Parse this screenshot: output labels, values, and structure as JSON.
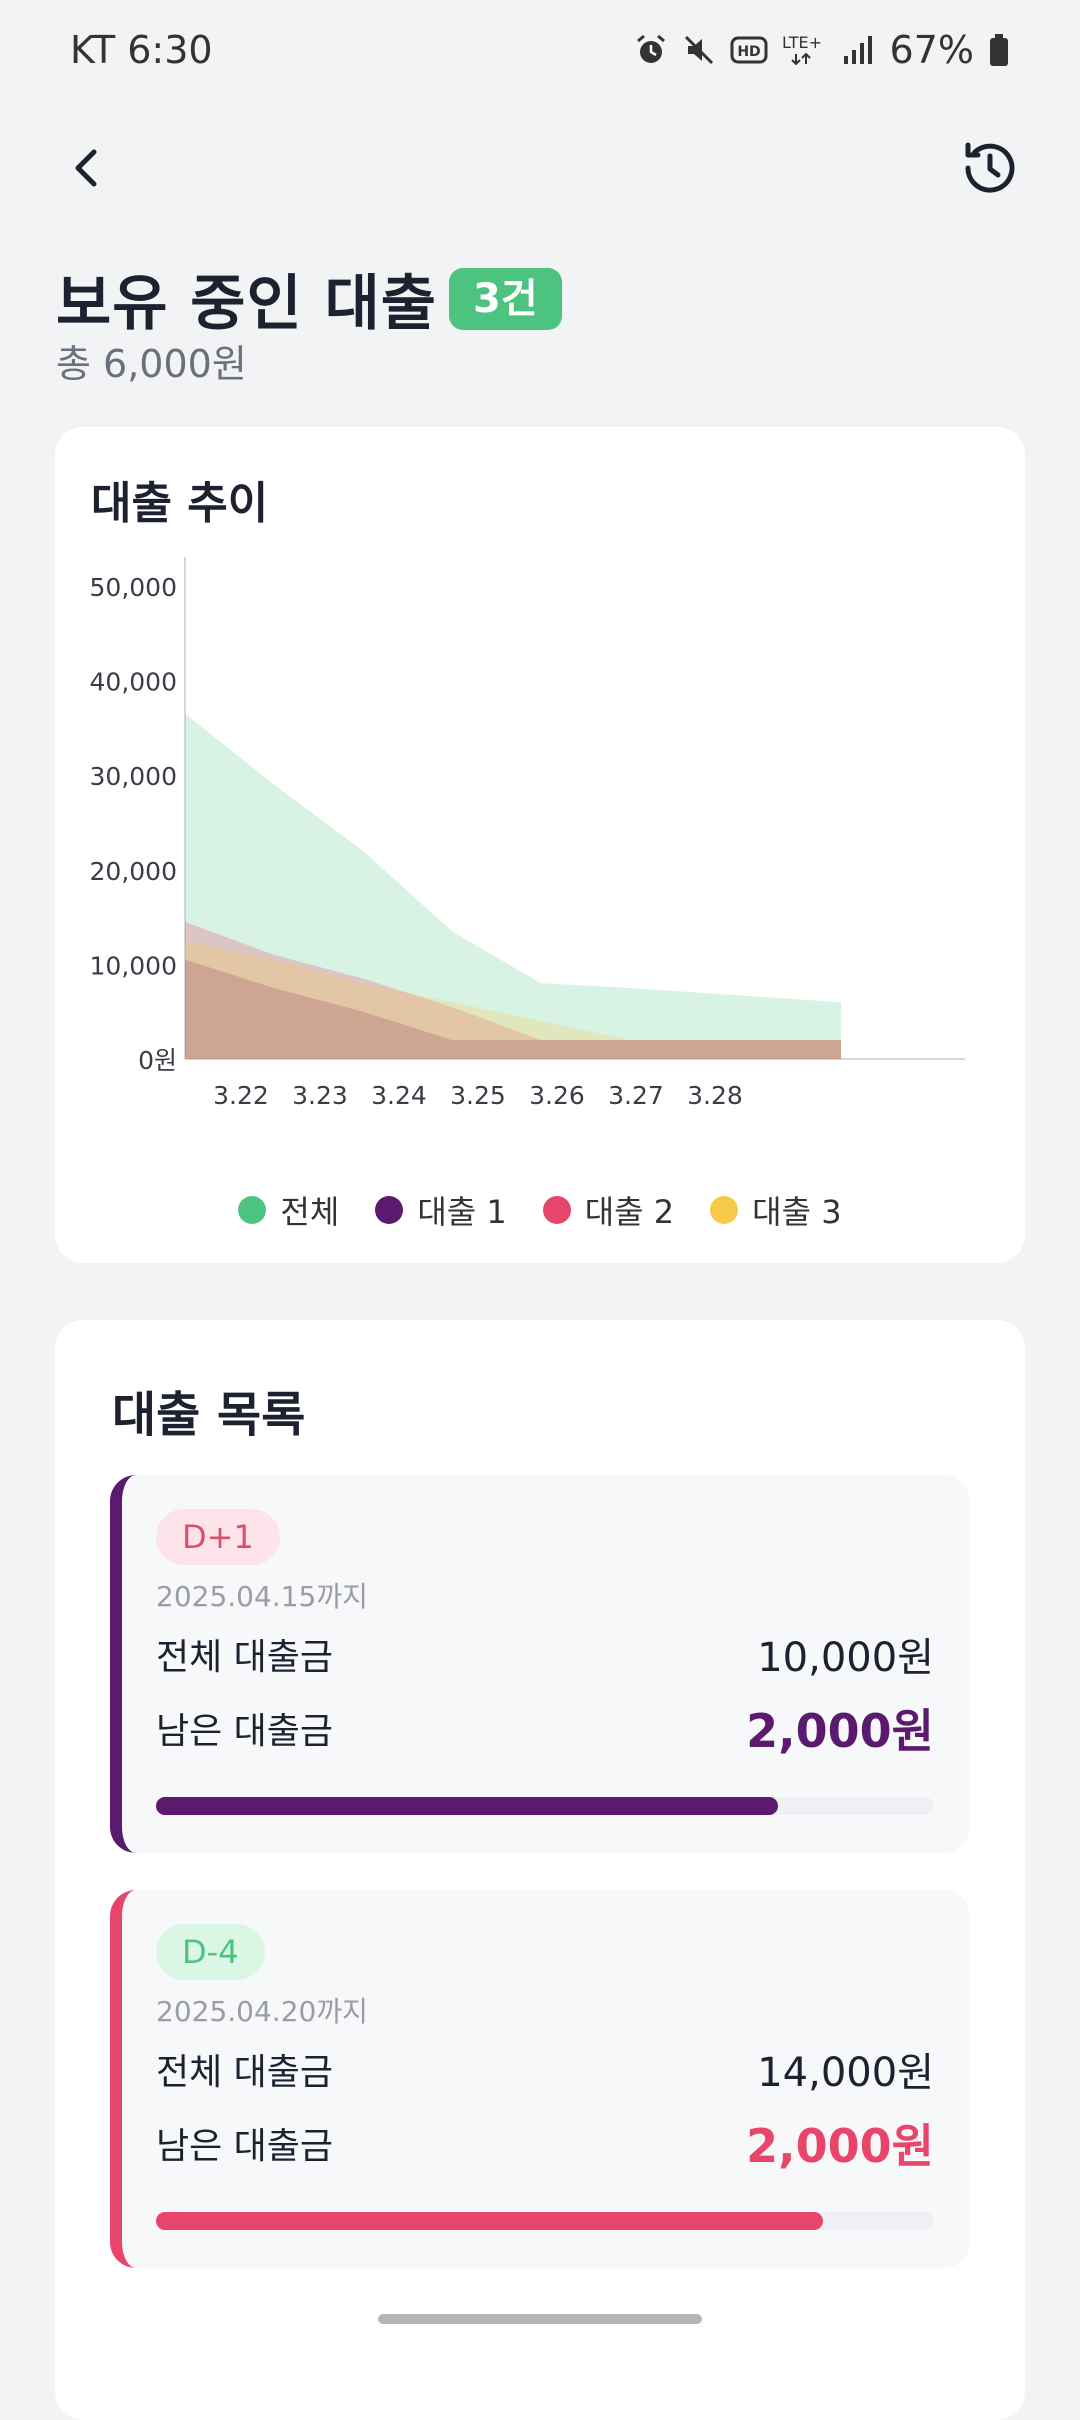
{
  "status_bar": {
    "carrier_time": "KT 6:30",
    "battery": "67%",
    "network": "LTE+",
    "hd": "HD",
    "icons": [
      "alarm-icon",
      "mute-icon",
      "hd-icon",
      "lte-icon",
      "signal-icon",
      "battery-icon"
    ]
  },
  "header": {
    "title": "보유 중인 대출",
    "count_badge": "3건",
    "subtitle": "총 6,000원"
  },
  "chart_card": {
    "title": "대출 추이"
  },
  "chart_data": {
    "type": "area",
    "title": "대출 추이",
    "categories": [
      "3.22",
      "3.23",
      "3.24",
      "3.25",
      "3.26",
      "3.27",
      "3.28"
    ],
    "y_ticks": [
      "0원",
      "10,000",
      "20,000",
      "30,000",
      "40,000",
      "50,000"
    ],
    "ylim": [
      0,
      52000
    ],
    "series": [
      {
        "name": "전체",
        "color": "#4cc47f",
        "values": [
          36500,
          29000,
          22000,
          13500,
          8000,
          7500,
          6000
        ]
      },
      {
        "name": "대출 1",
        "color": "#5b1a6e",
        "values": [
          10500,
          7500,
          5000,
          2000,
          2000,
          2000,
          2000
        ]
      },
      {
        "name": "대출 2",
        "color": "#e8456a",
        "values": [
          14500,
          11000,
          8500,
          5500,
          2000,
          2000,
          2000
        ]
      },
      {
        "name": "대출 3",
        "color": "#f7c948",
        "values": [
          12500,
          10500,
          8000,
          6000,
          4000,
          2000,
          2000
        ]
      }
    ],
    "legend": "bottom-center",
    "grid": false
  },
  "list_card": {
    "title": "대출 목록",
    "loans": [
      {
        "dday": "D+1",
        "due": "2025.04.15까지",
        "total_label": "전체 대출금",
        "total_value": "10,000원",
        "remain_label": "남은 대출금",
        "remain_value": "2,000원",
        "progress": 0.8,
        "accent": "#5b1a6e",
        "badge_bg": "#fde3ea",
        "badge_fg": "#d9506f"
      },
      {
        "dday": "D-4",
        "due": "2025.04.20까지",
        "total_label": "전체 대출금",
        "total_value": "14,000원",
        "remain_label": "남은 대출금",
        "remain_value": "2,000원",
        "progress": 0.857,
        "accent": "#e8456a",
        "badge_bg": "#dcf6e5",
        "badge_fg": "#4cc47f"
      }
    ]
  },
  "nav": {
    "back_icon": "back-arrow-icon",
    "history_icon": "history-icon"
  }
}
